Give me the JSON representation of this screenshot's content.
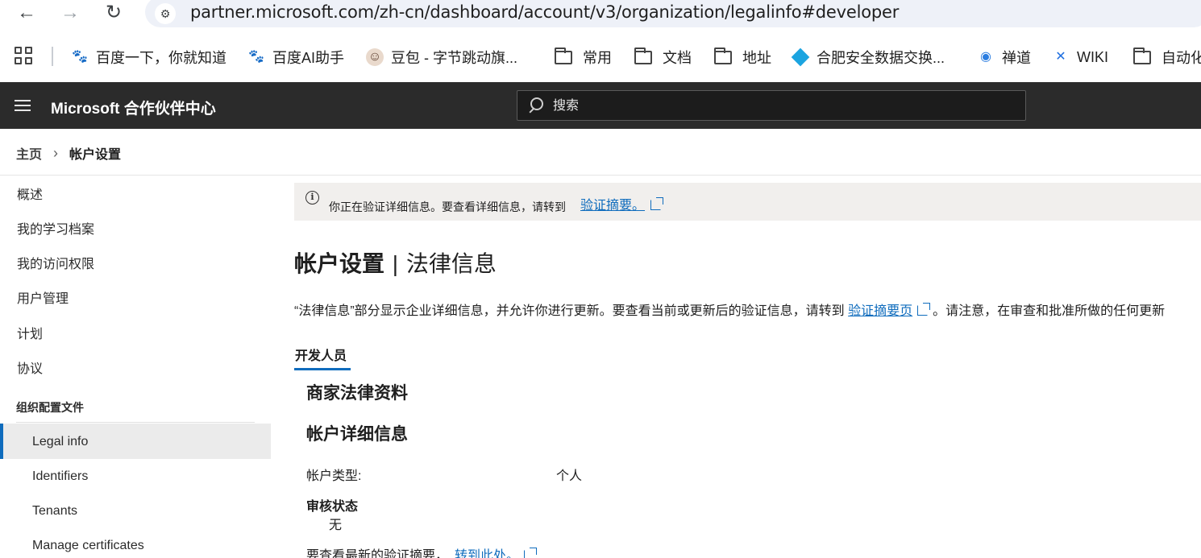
{
  "browser": {
    "url": "partner.microsoft.com/zh-cn/dashboard/account/v3/organization/legalinfo#developer"
  },
  "bookmarks": [
    {
      "label": "百度一下，你就知道",
      "icon": "baidu-paw-icon"
    },
    {
      "label": "百度AI助手",
      "icon": "baidu-paw-icon"
    },
    {
      "label": "豆包 - 字节跳动旗...",
      "icon": "doubao-avatar-icon"
    },
    {
      "label": "常用",
      "icon": "folder-icon"
    },
    {
      "label": "文档",
      "icon": "folder-icon"
    },
    {
      "label": "地址",
      "icon": "folder-icon"
    },
    {
      "label": "合肥安全数据交换...",
      "icon": "diamond-logo-icon"
    },
    {
      "label": "禅道",
      "icon": "zentao-logo-icon"
    },
    {
      "label": "WIKI",
      "icon": "confluence-logo-icon"
    },
    {
      "label": "自动化",
      "icon": "folder-icon"
    }
  ],
  "app": {
    "title": "Microsoft 合作伙伴中心",
    "search_placeholder": "搜索"
  },
  "breadcrumb": {
    "home": "主页",
    "current": "帐户设置"
  },
  "nav": {
    "items": [
      "概述",
      "我的学习档案",
      "我的访问权限",
      "用户管理",
      "计划",
      "协议"
    ],
    "group": "组织配置文件",
    "sub_items": [
      "Legal info",
      "Identifiers",
      "Tenants",
      "Manage certificates"
    ],
    "active": "Legal info"
  },
  "banner": {
    "text": "你正在验证详细信息。要查看详细信息，请转到",
    "link": "验证摘要。"
  },
  "page": {
    "title_bold": "帐户设置",
    "title_sep": "|",
    "title_sub": "法律信息",
    "desc_before": "“法律信息”部分显示企业详细信息，并允许你进行更新。要查看当前或更新后的验证信息，请转到",
    "desc_link": "验证摘要页",
    "desc_after": "。请注意，在审查和批准所做的任何更新",
    "tab": "开发人员",
    "section1": "商家法律资料",
    "section2": "帐户详细信息",
    "account_type_label": "帐户类型:",
    "account_type_value": "个人",
    "review_label": "审核状态",
    "review_value": "无",
    "latest_text": "要查看最新的验证摘要，",
    "latest_link": "转到此处。"
  },
  "colors": {
    "accent": "#0f6cbd",
    "header_bg": "#2b2b2b",
    "banner_bg": "#f1efed",
    "nav_active_bg": "#ebebeb"
  }
}
